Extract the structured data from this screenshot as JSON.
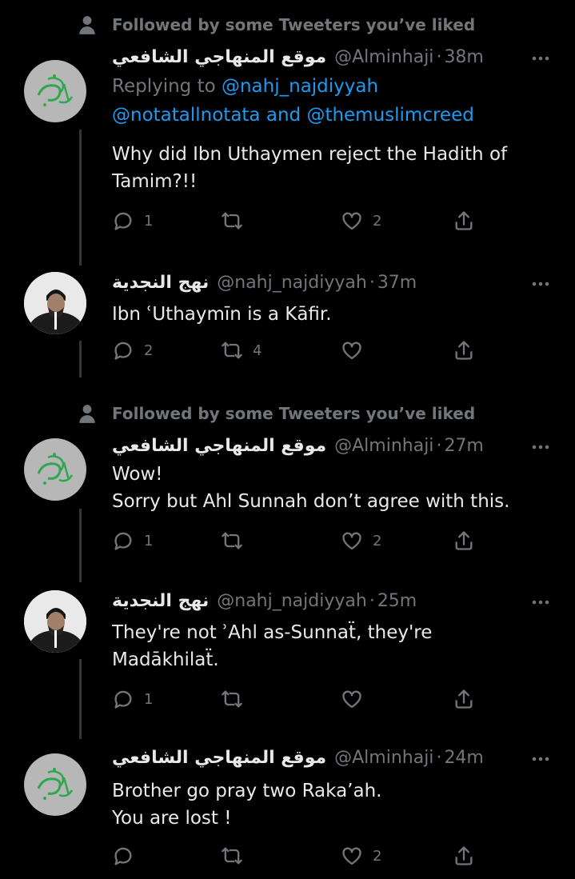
{
  "colors": {
    "background": "#000000",
    "text": "#e7e9ea",
    "secondary": "#71767b",
    "link": "#1d9bf0",
    "logo_green": "#2fa74f"
  },
  "tweets": [
    {
      "social_context": "Followed by some Tweeters you’ve liked",
      "name": "موقع المنهاجي الشافعي",
      "handle": "@Alminhaji",
      "time": "38m",
      "reply_label": "Replying to",
      "mention_1": "@nahj_najdiyyah",
      "mention_2": "@notatallnotata",
      "reply_and": "and",
      "mention_3": "@themuslimcreed",
      "text": "Why did Ibn Uthaymen reject the Hadith of\nTamim?!!",
      "replies": "1",
      "retweets": "",
      "likes": "2",
      "avatar_logo_text": "المنهاجي"
    },
    {
      "name": "نهج النجدية",
      "handle": "@nahj_najdiyyah",
      "time": "37m",
      "text": "Ibn ʿUthaymīn is a Kāfir.",
      "replies": "2",
      "retweets": "4",
      "likes": ""
    },
    {
      "social_context": "Followed by some Tweeters you’ve liked",
      "name": "موقع المنهاجي الشافعي",
      "handle": "@Alminhaji",
      "time": "27m",
      "text": "Wow!\nSorry but Ahl Sunnah don’t agree with this.",
      "replies": "1",
      "retweets": "",
      "likes": "2",
      "avatar_logo_text": "المنهاجي"
    },
    {
      "name": "نهج النجدية",
      "handle": "@nahj_najdiyyah",
      "time": "25m",
      "text": "They're not ʾAhl as-Sunnaẗ, they're\nMadākhilaẗ.",
      "replies": "1",
      "retweets": "",
      "likes": ""
    },
    {
      "name": "موقع المنهاجي الشافعي",
      "handle": "@Alminhaji",
      "time": "24m",
      "text": "Brother go pray two Raka’ah.\nYou are lost !",
      "replies": "",
      "retweets": "",
      "likes": "2",
      "avatar_logo_text": "المنهاجي"
    }
  ],
  "icons": {
    "social_context": "person-icon",
    "more": "more-icon",
    "reply": "reply-icon",
    "retweet": "retweet-icon",
    "like": "like-icon",
    "share": "share-icon"
  }
}
